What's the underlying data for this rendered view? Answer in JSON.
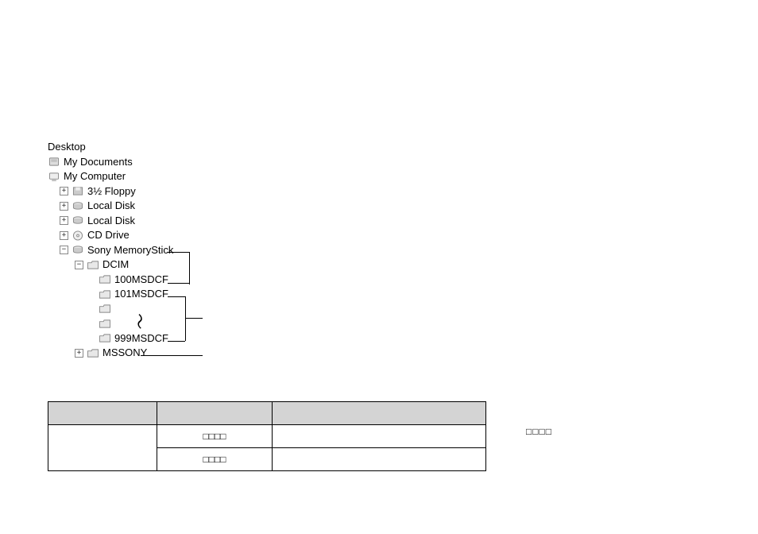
{
  "tree": {
    "root": "Desktop",
    "my_documents": "My Documents",
    "my_computer": "My Computer",
    "floppy": "3½ Floppy",
    "local_disk_1": "Local Disk",
    "local_disk_2": "Local Disk",
    "cd_drive": "CD Drive",
    "memorystick": "Sony MemoryStick",
    "dcim": "DCIM",
    "f100": "100MSDCF",
    "f101": "101MSDCF",
    "f999": "999MSDCF",
    "mssony": "MSSONY"
  },
  "expanders": {
    "plus": "+",
    "minus": "−"
  },
  "tilde": "〜",
  "table": {
    "header": {
      "c1": "",
      "c2": "",
      "c3": ""
    },
    "rows": [
      {
        "c2": "□□□□",
        "c3": ""
      },
      {
        "c2": "□□□□",
        "c3": ""
      }
    ],
    "merged_c1": ""
  },
  "side_label": "□□□□"
}
